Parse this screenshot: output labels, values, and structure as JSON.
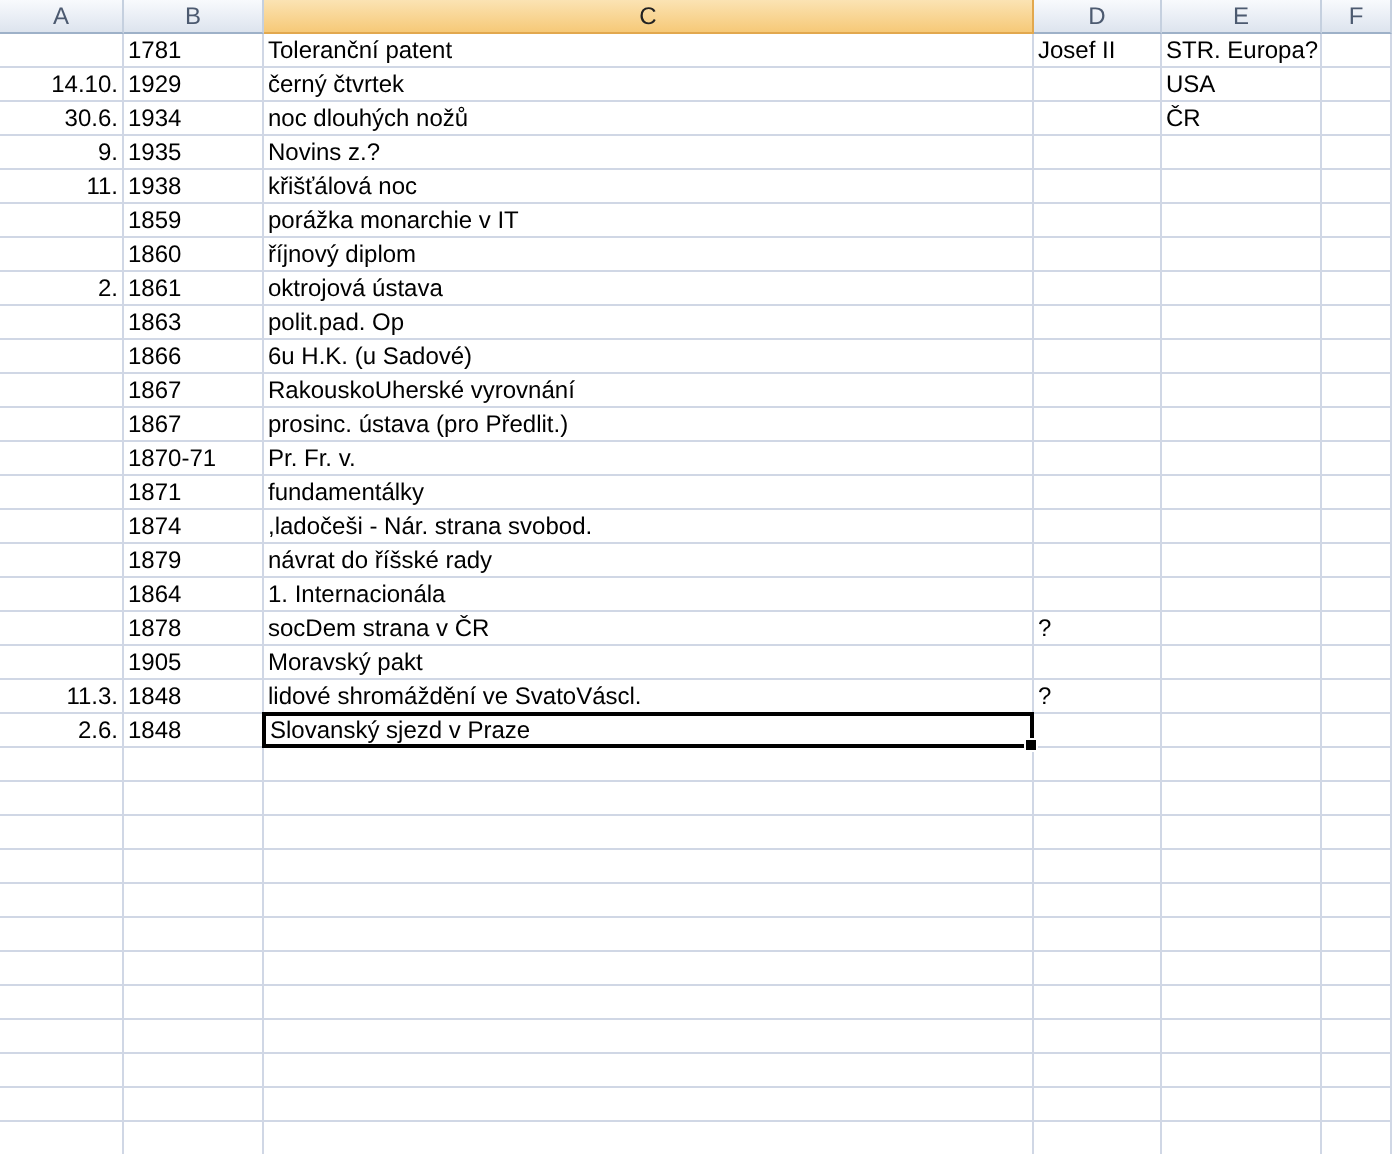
{
  "columns": [
    {
      "label": "A",
      "selected": false
    },
    {
      "label": "B",
      "selected": false
    },
    {
      "label": "C",
      "selected": true
    },
    {
      "label": "D",
      "selected": false
    },
    {
      "label": "E",
      "selected": false
    },
    {
      "label": "F",
      "selected": false
    }
  ],
  "rows": [
    {
      "b": "1781",
      "c": "Toleranční patent",
      "d": "Josef II",
      "e": "STR. Europa?",
      "selected": false
    },
    {
      "a": "14.10.",
      "b": "1929",
      "c": "černý čtvrtek",
      "e": "USA",
      "selected": false
    },
    {
      "a": "30.6.",
      "b": "1934",
      "c": "noc dlouhých nožů",
      "e": "ČR",
      "selected": false
    },
    {
      "a": "9.",
      "b": "1935",
      "c": "Novins z.?",
      "selected": false
    },
    {
      "a": "11.",
      "b": "1938",
      "c": "křišťálová noc",
      "selected": false
    },
    {
      "b": "1859",
      "c": "porážka monarchie v IT",
      "selected": false
    },
    {
      "b": "1860",
      "c": "říjnový diplom",
      "selected": false
    },
    {
      "a": "2.",
      "b": "1861",
      "c": "oktrojová ústava",
      "selected": false
    },
    {
      "b": "1863",
      "c": "polit.pad. Op",
      "selected": false
    },
    {
      "b": "1866",
      "c": "6u H.K. (u Sadové)",
      "selected": false
    },
    {
      "b": "1867",
      "c": "RakouskoUherské vyrovnání",
      "selected": false
    },
    {
      "b": "1867",
      "c": "prosinc. ústava (pro Předlit.)",
      "selected": false
    },
    {
      "b": "1870-71",
      "c": "Pr. Fr. v.",
      "selected": false
    },
    {
      "b": "1871",
      "c": "fundamentálky",
      "selected": false
    },
    {
      "b": "1874",
      "c": ",ladočeši - Nár. strana svobod.",
      "selected": false
    },
    {
      "b": "1879",
      "c": "návrat do říšské rady",
      "selected": false
    },
    {
      "b": "1864",
      "c": "1. Internacionála",
      "selected": false
    },
    {
      "b": "1878",
      "c": "socDem strana v ČR",
      "d": "?",
      "selected": false
    },
    {
      "b": "1905",
      "c": "Moravský pakt",
      "selected": false
    },
    {
      "a": "11.3.",
      "b": "1848",
      "c": "lidové shromáždění ve SvatoVáscl.",
      "d": "?",
      "selected": false
    },
    {
      "a": "2.6.",
      "b": "1848",
      "c": "Slovanský sjezd v Praze",
      "selected": true
    }
  ]
}
